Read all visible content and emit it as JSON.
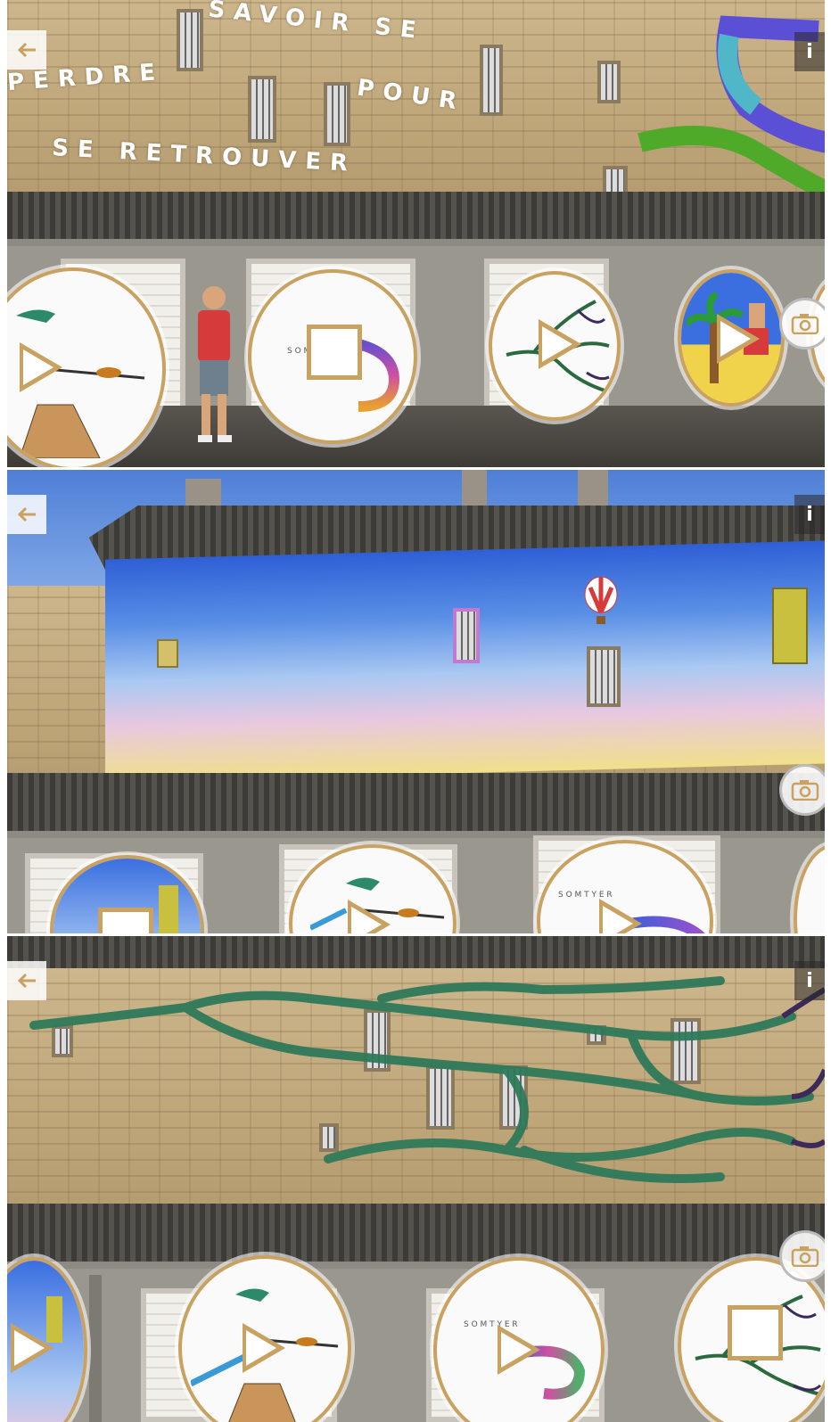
{
  "panels": [
    {
      "id": "panel-1",
      "ar_text": {
        "line1": "SAVOIR SE",
        "line2": "PERDRE",
        "line3": "POUR",
        "line4": "SE RETROUVER"
      },
      "back_icon": "arrow-left-icon",
      "info_label": "i",
      "camera_icon": "camera-icon",
      "bubbles": [
        {
          "artwork": "boat-ladder",
          "control": "play"
        },
        {
          "artwork": "spiral-letters",
          "control": "stop"
        },
        {
          "artwork": "green-roots",
          "control": "play"
        },
        {
          "artwork": "palm-figure",
          "control": "play"
        }
      ]
    },
    {
      "id": "panel-2",
      "back_icon": "arrow-left-icon",
      "info_label": "i",
      "camera_icon": "camera-icon",
      "bubbles": [
        {
          "artwork": "sky-mural",
          "control": "stop"
        },
        {
          "artwork": "boat-ladder",
          "control": "play"
        },
        {
          "artwork": "spiral-letters",
          "control": "play"
        }
      ]
    },
    {
      "id": "panel-3",
      "back_icon": "arrow-left-icon",
      "info_label": "i",
      "camera_icon": "camera-icon",
      "bubbles": [
        {
          "artwork": "sky-mural",
          "control": "play"
        },
        {
          "artwork": "boat-ladder",
          "control": "play"
        },
        {
          "artwork": "spiral-letters",
          "control": "play"
        },
        {
          "artwork": "green-roots",
          "control": "stop"
        }
      ]
    }
  ],
  "colors": {
    "accent_gold": "#c9a160",
    "sky_blue": "#4c78d8",
    "root_green": "#2f7a5a"
  }
}
